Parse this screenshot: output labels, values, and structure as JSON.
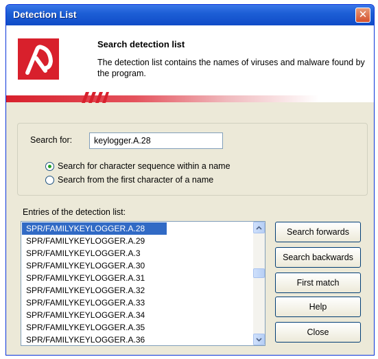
{
  "window": {
    "title": "Detection List",
    "close_glyph": "✕"
  },
  "header": {
    "title": "Search detection list",
    "description": "The detection list contains the names of viruses and malware found by the program.",
    "brand_color": "#d8202c"
  },
  "search": {
    "label": "Search for:",
    "value": "keylogger.A.28",
    "options": [
      {
        "label": "Search for character sequence within a name",
        "selected": true
      },
      {
        "label": "Search from the first character of a name",
        "selected": false
      }
    ]
  },
  "entries": {
    "label": "Entries of the detection list:",
    "items": [
      "SPR/FAMILYKEYLOGGER.A.28",
      "SPR/FAMILYKEYLOGGER.A.29",
      "SPR/FAMILYKEYLOGGER.A.3",
      "SPR/FAMILYKEYLOGGER.A.30",
      "SPR/FAMILYKEYLOGGER.A.31",
      "SPR/FAMILYKEYLOGGER.A.32",
      "SPR/FAMILYKEYLOGGER.A.33",
      "SPR/FAMILYKEYLOGGER.A.34",
      "SPR/FAMILYKEYLOGGER.A.35",
      "SPR/FAMILYKEYLOGGER.A.36"
    ],
    "selected_index": 0
  },
  "buttons": {
    "search_forwards": "Search forwards",
    "search_backwards": "Search backwards",
    "first_match": "First match",
    "help": "Help",
    "close": "Close"
  },
  "icons": {
    "logo": "avira-umbrella-logo-icon",
    "scroll_up": "chevron-up-icon",
    "scroll_down": "chevron-down-icon"
  }
}
